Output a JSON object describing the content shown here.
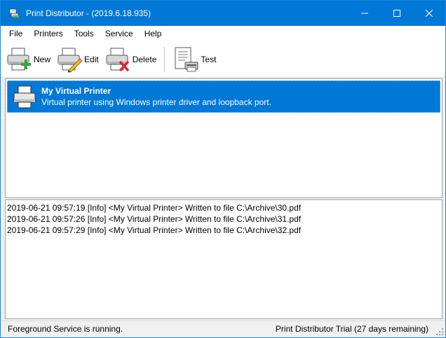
{
  "window": {
    "title": "Print Distributor - (2019.6.18.935)",
    "accent_color": "#0078d7"
  },
  "titlebar_buttons": [
    "minimize-icon",
    "maximize-icon",
    "close-icon"
  ],
  "menu": [
    "File",
    "Printers",
    "Tools",
    "Service",
    "Help"
  ],
  "toolbar": {
    "new_label": "New",
    "edit_label": "Edit",
    "delete_label": "Delete",
    "test_label": "Test"
  },
  "printers": [
    {
      "name": "My Virtual Printer",
      "description": "Virtual printer using Windows printer driver and loopback port.",
      "selected": true
    }
  ],
  "log": [
    "2019-06-21 09:57:19 [Info] <My Virtual Printer> Written to file C:\\Archive\\30.pdf",
    "2019-06-21 09:57:26 [Info] <My Virtual Printer> Written to file C:\\Archive\\31.pdf",
    "2019-06-21 09:57:29 [Info] <My Virtual Printer> Written to file C:\\Archive\\32.pdf"
  ],
  "status": {
    "left": "Foreground Service is running.",
    "right": "Print Distributor Trial (27 days remaining)"
  }
}
